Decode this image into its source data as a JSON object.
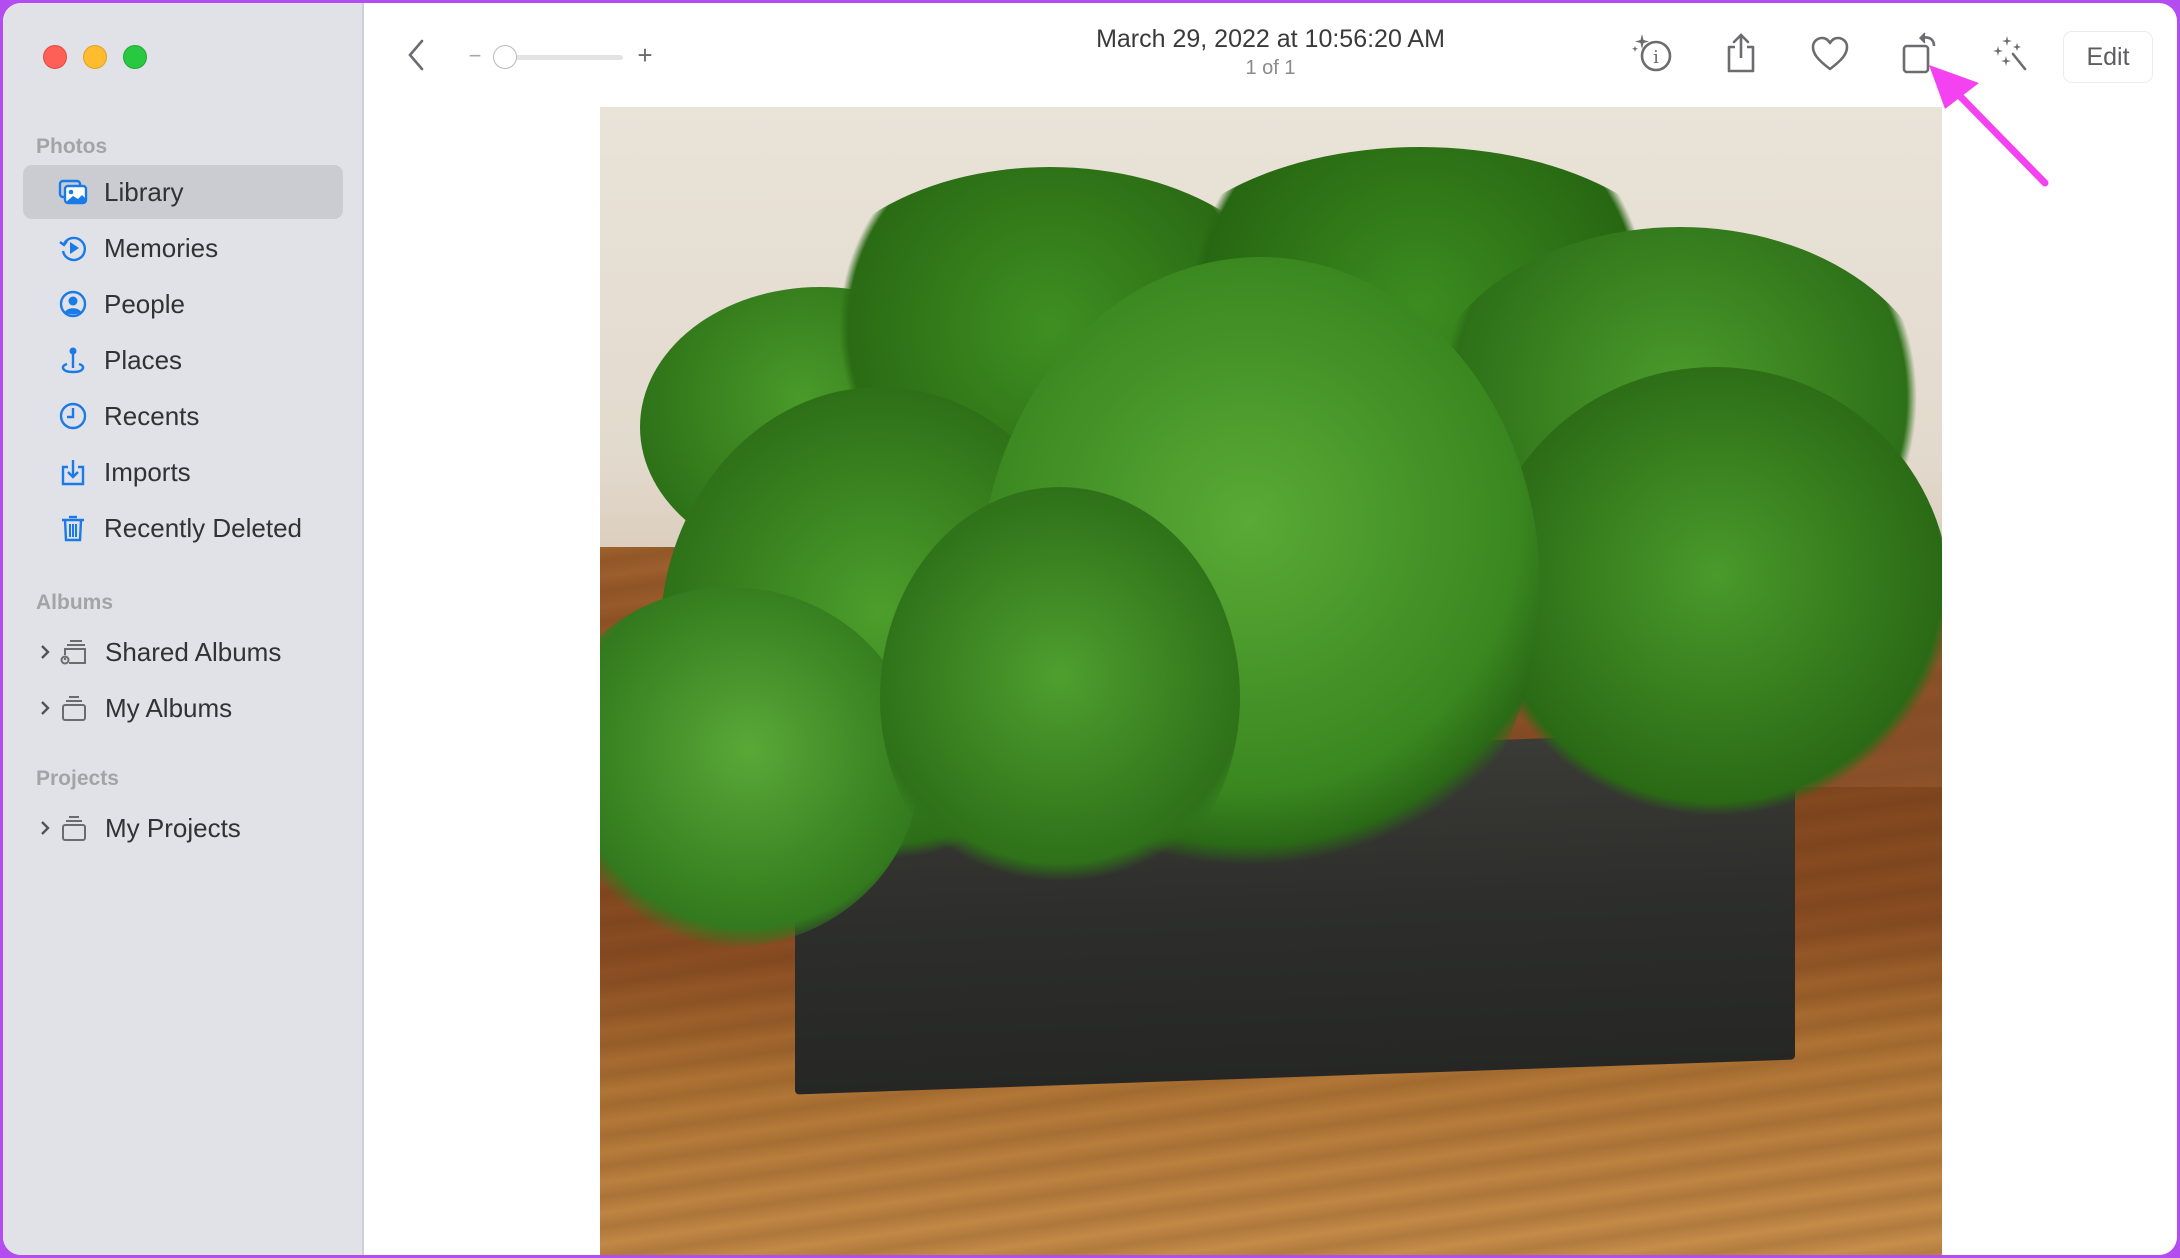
{
  "window": {
    "traffic_lights": [
      "close",
      "minimize",
      "zoom"
    ]
  },
  "sidebar": {
    "sections": [
      {
        "label": "Photos",
        "items": [
          {
            "label": "Library",
            "icon": "library-icon",
            "selected": true
          },
          {
            "label": "Memories",
            "icon": "memories-icon"
          },
          {
            "label": "People",
            "icon": "people-icon"
          },
          {
            "label": "Places",
            "icon": "places-icon"
          },
          {
            "label": "Recents",
            "icon": "recents-icon"
          },
          {
            "label": "Imports",
            "icon": "imports-icon"
          },
          {
            "label": "Recently Deleted",
            "icon": "trash-icon"
          }
        ]
      },
      {
        "label": "Albums",
        "items": [
          {
            "label": "Shared Albums",
            "icon": "shared-album-icon",
            "expandable": true
          },
          {
            "label": "My Albums",
            "icon": "album-stack-icon",
            "expandable": true
          }
        ]
      },
      {
        "label": "Projects",
        "items": [
          {
            "label": "My Projects",
            "icon": "album-stack-icon",
            "expandable": true
          }
        ]
      }
    ]
  },
  "toolbar": {
    "back_icon": "chevron-left-icon",
    "zoom_minus": "−",
    "zoom_plus": "+",
    "zoom_level": 0,
    "title": "March 29, 2022 at 10:56:20 AM",
    "subtitle": "1 of 1",
    "actions": [
      {
        "name": "info",
        "icon": "info-sparkle-icon"
      },
      {
        "name": "share",
        "icon": "share-icon"
      },
      {
        "name": "favorite",
        "icon": "heart-icon"
      },
      {
        "name": "rotate",
        "icon": "rotate-icon"
      },
      {
        "name": "enhance",
        "icon": "magic-wand-icon"
      }
    ],
    "edit_label": "Edit"
  },
  "photo": {
    "description": "Green preserved moss in a dark rectangular planter on a wooden surface"
  },
  "annotation": {
    "color": "#f542f0",
    "points_to": "rotate"
  },
  "colors": {
    "accent": "#1a7ae8",
    "sidebar_bg": "#e1e2e7",
    "selected_bg": "#cbccd1",
    "frame": "#b34df0"
  }
}
